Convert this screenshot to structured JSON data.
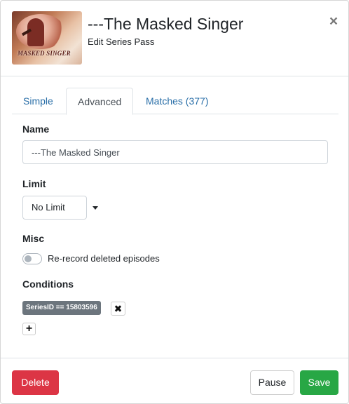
{
  "header": {
    "poster": {
      "wordmark": "MASKED SINGER",
      "icon": "poster-image"
    },
    "title": "---The Masked Singer",
    "subtitle": "Edit Series Pass",
    "close_label": "×"
  },
  "tabs": [
    {
      "label": "Simple",
      "active": false
    },
    {
      "label": "Advanced",
      "active": true
    },
    {
      "label": "Matches (377)",
      "active": false
    }
  ],
  "form": {
    "name": {
      "label": "Name",
      "value": "---The Masked Singer"
    },
    "limit": {
      "label": "Limit",
      "selected": "No Limit"
    },
    "misc": {
      "label": "Misc",
      "toggle_label": "Re-record deleted episodes",
      "toggle_on": false
    },
    "conditions": {
      "label": "Conditions",
      "items": [
        {
          "text": "SeriesID == 15803596",
          "remove_label": "✖"
        }
      ],
      "add_label": "+"
    }
  },
  "footer": {
    "delete_label": "Delete",
    "pause_label": "Pause",
    "save_label": "Save"
  },
  "colors": {
    "link": "#2a6fa8",
    "danger": "#dc3545",
    "success": "#28a745",
    "chip": "#6c757d"
  }
}
